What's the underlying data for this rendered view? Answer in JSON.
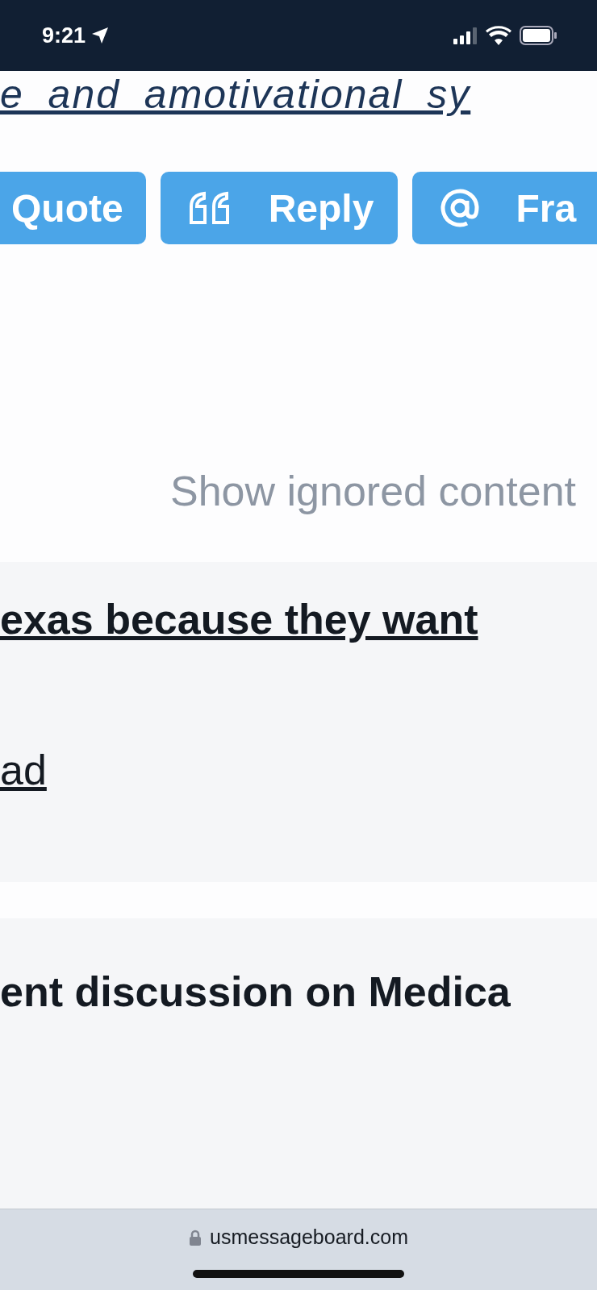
{
  "status_bar": {
    "time": "9:21"
  },
  "link_text": "e_and_amotivational_sy",
  "buttons": [
    {
      "label": "Quote",
      "kind": "plain"
    },
    {
      "label": "Reply",
      "kind": "quote"
    },
    {
      "label": "Fra",
      "kind": "mention"
    }
  ],
  "show_ignored": "Show ignored content",
  "sections": [
    {
      "lines": [
        {
          "text": "exas because they want",
          "kind": "bold-link"
        },
        {
          "text": "ad",
          "kind": "link"
        }
      ]
    },
    {
      "lines": [
        {
          "text": "ent discussion on Medica",
          "kind": "bold"
        }
      ]
    }
  ],
  "browser_bar": {
    "url": "usmessageboard.com"
  }
}
